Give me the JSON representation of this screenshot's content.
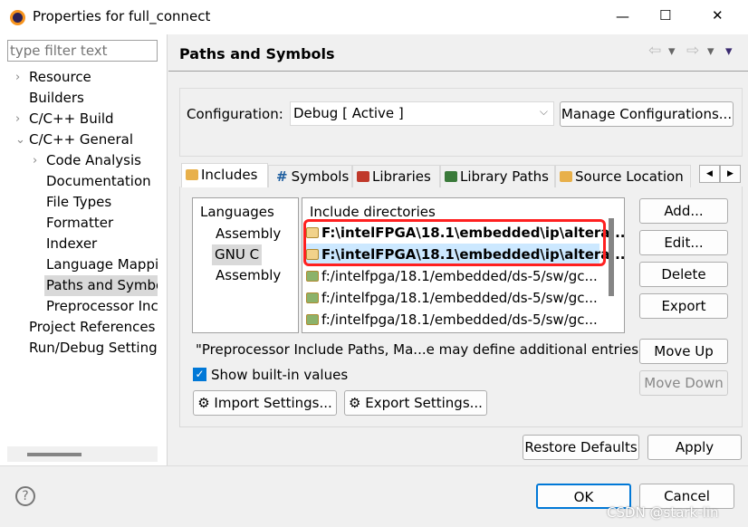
{
  "window": {
    "title": "Properties for full_connect",
    "minimize": "—",
    "maximize": "☐",
    "close": "✕"
  },
  "sidebar": {
    "filter_placeholder": "type filter text",
    "items": [
      {
        "label": "Resource",
        "arrow": "›"
      },
      {
        "label": "Builders",
        "arrow": ""
      },
      {
        "label": "C/C++ Build",
        "arrow": "›"
      },
      {
        "label": "C/C++ General",
        "arrow": "⌄"
      },
      {
        "label": "Code Analysis",
        "arrow": "›"
      },
      {
        "label": "Documentation",
        "arrow": ""
      },
      {
        "label": "File Types",
        "arrow": ""
      },
      {
        "label": "Formatter",
        "arrow": ""
      },
      {
        "label": "Indexer",
        "arrow": ""
      },
      {
        "label": "Language Mappi",
        "arrow": ""
      },
      {
        "label": "Paths and Symbo",
        "arrow": ""
      },
      {
        "label": "Preprocessor Inc",
        "arrow": ""
      },
      {
        "label": "Project References",
        "arrow": ""
      },
      {
        "label": "Run/Debug Settings",
        "arrow": ""
      }
    ]
  },
  "header": {
    "title": "Paths and Symbols",
    "back": "⇦",
    "fwd": "⇨",
    "menu": "▾"
  },
  "config": {
    "label": "Configuration:",
    "value": "Debug  [ Active ]",
    "manage": "Manage Configurations..."
  },
  "tabs": [
    "Includes",
    "Symbols",
    "Libraries",
    "Library Paths",
    "Source Location"
  ],
  "languages": {
    "header": "Languages",
    "items": [
      "Assembly",
      "GNU C",
      "Assembly"
    ]
  },
  "includes": {
    "header": "Include directories",
    "rows": [
      "F:\\intelFPGA\\18.1\\embedded\\ip\\altera...",
      "F:\\intelFPGA\\18.1\\embedded\\ip\\altera...",
      "f:/intelfpga/18.1/embedded/ds-5/sw/gc...",
      "f:/intelfpga/18.1/embedded/ds-5/sw/gc...",
      "f:/intelfpga/18.1/embedded/ds-5/sw/gc..."
    ]
  },
  "side_buttons": [
    "Add...",
    "Edit...",
    "Delete",
    "Export",
    "Move Up",
    "Move Down"
  ],
  "note": "\"Preprocessor Include Paths, Ma...e may define additional entries",
  "show_builtin": {
    "label": "Show built-in values",
    "checked": true
  },
  "import_btn": "Import Settings...",
  "export_btn": "Export Settings...",
  "restore": "Restore Defaults",
  "apply": "Apply",
  "ok": "OK",
  "cancel": "Cancel",
  "help": "?",
  "watermark": "CSDN @stark-lin",
  "colors": {
    "highlight": "#ff2020",
    "selected_row": "#cce8ff"
  }
}
